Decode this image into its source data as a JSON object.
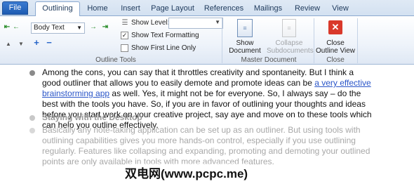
{
  "tabs": [
    "File",
    "Outlining",
    "Home",
    "Insert",
    "Page Layout",
    "References",
    "Mailings",
    "Review",
    "View"
  ],
  "ribbon": {
    "level_value": "Body Text",
    "show_level_label": "Show Level:",
    "show_text_formatting_label": "Show Text Formatting",
    "show_text_formatting_checked": true,
    "show_first_line_only_label": "Show First Line Only",
    "show_first_line_only_checked": false,
    "outline_tools_label": "Outline Tools",
    "show_document_line1": "Show",
    "show_document_line2": "Document",
    "collapse_subdocs_line1": "Collapse",
    "collapse_subdocs_line2": "Subdocuments",
    "master_document_label": "Master Document",
    "close_outline_line1": "Close",
    "close_outline_line2": "Outline View",
    "close_group_label": "Close"
  },
  "document": {
    "para1_before_link": "Among the cons, you can say that it throttles creativity and spontaneity. But I think a good outliner that allows you to easily demote and promote ideas can be ",
    "para1_link": "a very effective brainstorming app",
    "para1_after_link": " as well. Yes, it might not be for everyone. So, I always say – do the best with the tools you have. So, if you are in favor of outlining your thoughts and ideas before you start work on your creative project, say aye and move on to these tools which can help you outline effectively.",
    "heading": "Staying with the Desktop",
    "para2": "Basically any note-taking application can be set up as an outliner. But using tools with outlining capabilities gives you more hands-on control, especially if you use outlining regularly. Features like collapsing and expanding, promoting and demoting your outlined points are only available in tools with more advanced features."
  },
  "watermark": "双电网(www.pcpc.me)",
  "colors": {
    "file_tab": "#2a67c0",
    "link": "#2a55c8",
    "close_icon": "#d9392b"
  }
}
